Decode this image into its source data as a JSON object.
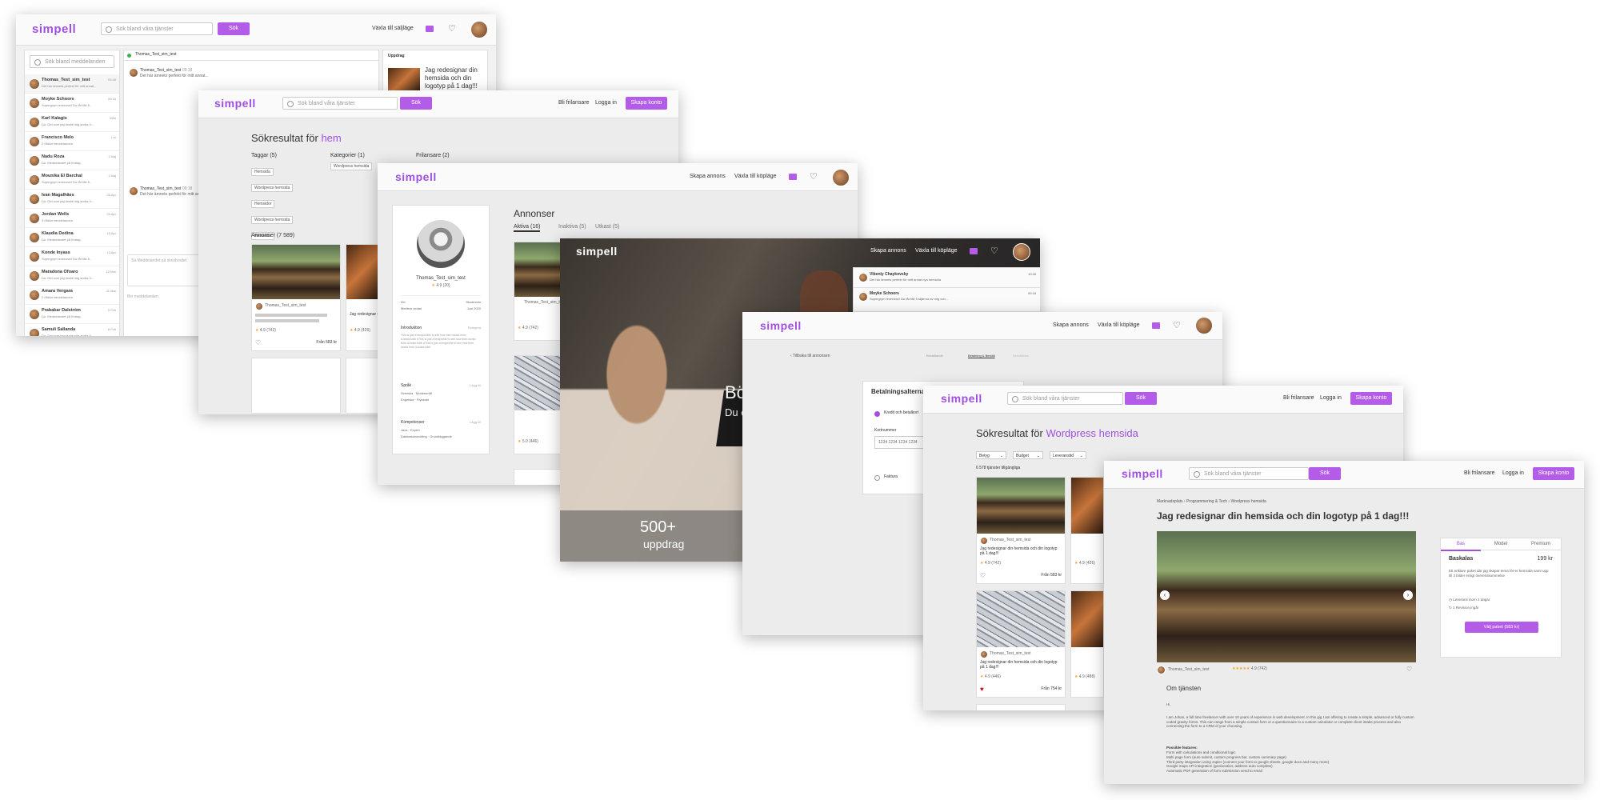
{
  "brand": {
    "logo": "simpell",
    "accent": "#a04fe0"
  },
  "p1": {
    "search_placeholder": "Sök bland våra tjänster",
    "search_btn": "Sök",
    "switch_label": "Växla till säljläge",
    "msg_search": "Sök bland meddelanden",
    "conversations": [
      {
        "name": "Thomas_Test_sim_test",
        "time": "09:48",
        "preview": "Det här ämnets perfekt för mitt annat..."
      },
      {
        "name": "Moyke Schoors",
        "time": "09:18",
        "preview": "Supergrym leverans!! Du får fält 5..."
      },
      {
        "name": "Karl Kalagis",
        "time": "Mån",
        "preview": "Du: Det som jag skulle slig andra ti..."
      },
      {
        "name": "Francisco Melo",
        "time": "Lör",
        "preview": "2 rådda meddelanden"
      },
      {
        "name": "Nadu Roza",
        "time": "1 Maj",
        "preview": "Du: Meddelandet på fredag."
      },
      {
        "name": "Mounika El Barchal",
        "time": "1 Maj",
        "preview": "Supergrym leverans!! Du får fält 5..."
      },
      {
        "name": "Ivan Magalhães",
        "time": "25 Apr",
        "preview": "Du: Det som jag skulle slig andra ti..."
      },
      {
        "name": "Jordan Wells",
        "time": "20 Apr",
        "preview": "3 rådda meddelanden"
      },
      {
        "name": "Klaudia Dedina",
        "time": "15 Apr",
        "preview": "Du: Meddelandet på fredag."
      },
      {
        "name": "Konde Inyass",
        "time": "13 Apr",
        "preview": "Supergrym leverans!! Du får fält 5..."
      },
      {
        "name": "Maradona Ofoaro",
        "time": "12 Mar",
        "preview": "Du: Det som jag skulle slig andra ti..."
      },
      {
        "name": "Amara Vergara",
        "time": "11 Mar",
        "preview": "2 rådda meddelanden"
      },
      {
        "name": "Prabakar Dalstróm",
        "time": "9 Feb",
        "preview": "Du: Meddelandet på fredag."
      },
      {
        "name": "Samuli Sallanda",
        "time": "8 Feb",
        "preview": "Du: Det som jag skulle slig andra ti..."
      }
    ],
    "chat_header": "Thomas_Test_sim_test",
    "chat_sender": "Thomas_Test_sim_test",
    "chat_sender_time": "09:18",
    "chat_msg": "Det här ämnets perfekt för mitt annat...",
    "chat_placeholder": "Sä Meddelandet på skrivbordet",
    "chat_footer": "Bin meddelanden",
    "uppdrag_title": "Uppdrag",
    "uppdrag_text": "Jag redesignar din hemsida och din logotyp på 1 dag!!!"
  },
  "p2": {
    "search_placeholder": "Sök bland våra tjänster",
    "search_btn": "Sök",
    "nav_freelancer": "Bli frilansare",
    "nav_login": "Logga in",
    "nav_create": "Skapa konto",
    "heading_prefix": "Sökresultat för ",
    "heading_term": "hem",
    "tags_label": "Taggar (5)",
    "tags": [
      "Hemsida",
      "Wordpress hemsida",
      "Hemsidor",
      "Wordpress hemsida",
      "Hemsidor",
      "Hemsidor"
    ],
    "cats_label": "Kategorier (1)",
    "cats": [
      "Wordpress hemsida"
    ],
    "freelancers_label": "Frilansare (2)",
    "ads_label": "Annonser (7 589)",
    "card1_user": "Thomas_Test_sim_test",
    "card1_rating": "4.9 (742)",
    "card1_price": "Från 583 kr",
    "card2_title": "Jag redesignar din hemsida och din logotyp",
    "card2_rating": "4.9 (426)"
  },
  "p3": {
    "nav_create_ad": "Skapa annons",
    "nav_switch": "Växla till köpläge",
    "profile_name": "Thomas_Test_sim_test",
    "profile_rating": "4.9 (20)",
    "from_label": "Ort",
    "from_value": "Stockholm",
    "member_label": "Medlem sedan",
    "member_value": "Juni 2020",
    "intro_label": "Introduktion",
    "intro_edit": "Redigera",
    "intro_text": "This is just a temporöfile to see how then works from #JuniorJobb #This is just a testprofile to see how then works from #JuniorJobb #This is just a testprofile to see how then works from #JuniorJobb",
    "lang_label": "Språk",
    "lang_add": "Lägg till",
    "lang1": "Svenska · Modersmål",
    "lang2": "Engelska · Flytande",
    "skills_label": "Kompetenser",
    "skills_add": "Lägg till",
    "skill1": "Java · Expert",
    "skill2": "Databasutveckling · Grundläggande",
    "ads_title": "Annonser",
    "tab_active": "Aktiva (16)",
    "tab_inactive": "Inaktiva (5)",
    "tab_draft": "Utkast (5)",
    "card_user": "Thomas_Test_sim_test",
    "card_rating": "4.9 (742)",
    "card_rating2": "5.0 (446)"
  },
  "p4": {
    "nav_create_ad": "Skapa annons",
    "nav_switch": "Växla till köpläge",
    "notif1_name": "Vibeniy Chaykovsky",
    "notif1_time": "10:48",
    "notif1_text": "Det här ämnets perfekt för mitt annat nya hemsida",
    "notif2_name": "Moyke Schoors",
    "notif2_time": "09:18",
    "notif2_text": "Supergrym leverans!! Du får fält 5 stjärnor av mig och...",
    "hero_partial": "Bö",
    "hero_partial2": "Du c",
    "stat_number": "500+",
    "stat_label": "uppdrag"
  },
  "p5": {
    "nav_create_ad": "Skapa annons",
    "nav_switch": "Växla till köpläge",
    "back_link": "Tillbaka till annonsen",
    "step1": "Beställande",
    "step2": "Betalning & Beställ",
    "step3": "Bekräftelse",
    "payment_title": "Betalningsalternativ",
    "option_card": "Kredit och betalkort",
    "card_number_label": "Kortnummer",
    "card_number_value": "1234 1234 1234 1234",
    "option_invoice": "Faktura"
  },
  "p6": {
    "search_placeholder": "Sök bland våra tjänster",
    "search_btn": "Sök",
    "nav_freelancer": "Bli frilansare",
    "nav_login": "Logga in",
    "nav_create": "Skapa konto",
    "heading_prefix": "Sökresultat för ",
    "heading_term": "Wordpress hemsida",
    "filter1": "Betyg",
    "filter2": "Budget",
    "filter3": "Leveranstid",
    "count_label": "6 578 tjänster tillgängliga",
    "card_user": "Thomas_Test_sim_test",
    "card_title": "Jag redesignar din hemsida och din logotyp på 1 dag!!!",
    "card_rating": "4.9 (742)",
    "card_price": "Från 583 kr",
    "card_rating2": "4.9 (426)",
    "card2_title": "Jag redesignar din hemsida och din logotyp på 1 dag!!!",
    "card2_rating": "4.9 (446)",
    "card2_price": "Från 754 kr",
    "card_rating3": "4.9 (488)"
  },
  "p7": {
    "search_placeholder": "Sök bland våra tjänster",
    "search_btn": "Sök",
    "nav_freelancer": "Bli frilansare",
    "nav_login": "Logga in",
    "nav_create": "Skapa konto",
    "crumbs": [
      "Marknadsplats",
      "Programmering & Tech",
      "Wordpress hemsida"
    ],
    "title": "Jag redesignar din hemsida och din logotyp på 1 dag!!!",
    "seller": "Thomas_Test_sim_test",
    "rating": "4.9 (742)",
    "pkg_tabs": [
      "Bas",
      "Model",
      "Premium"
    ],
    "pkg_name": "Baskalas",
    "pkg_price": "199 kr",
    "pkg_desc": "Ett enklare paket där jag skapar tema för er hemsida samt upp till 3 bilder enligt överenskommelse",
    "pkg_delivery": "Leverans inom 2 dagar",
    "pkg_revision": "1 Revision ingår",
    "pkg_btn": "Välj paket (583 kr)",
    "about_title": "Om tjänsten",
    "about_hi": "Hi,",
    "about_p1": "I am Johan, a full time freelancer with over 10 years of experience in web development. In this gig I am offering to create a simple, advanced or fully custom coded gravity forms. This can range from a simple contact form or a questionnaire to a custom calculator or complete client intake process and also connecting the form to a CRM of your choosing.",
    "about_features": "Possible features:",
    "features": [
      "Form with calculations and conditional logic",
      "Multi page form (auto submit, custom progress bar, custom summary page)",
      "Third party integration using zapier (connect your form to google sheets, google docs and many more)",
      "Google maps API integration (geolocation, address auto complete)",
      "Automatic PDF generation of form submission send to email"
    ]
  }
}
